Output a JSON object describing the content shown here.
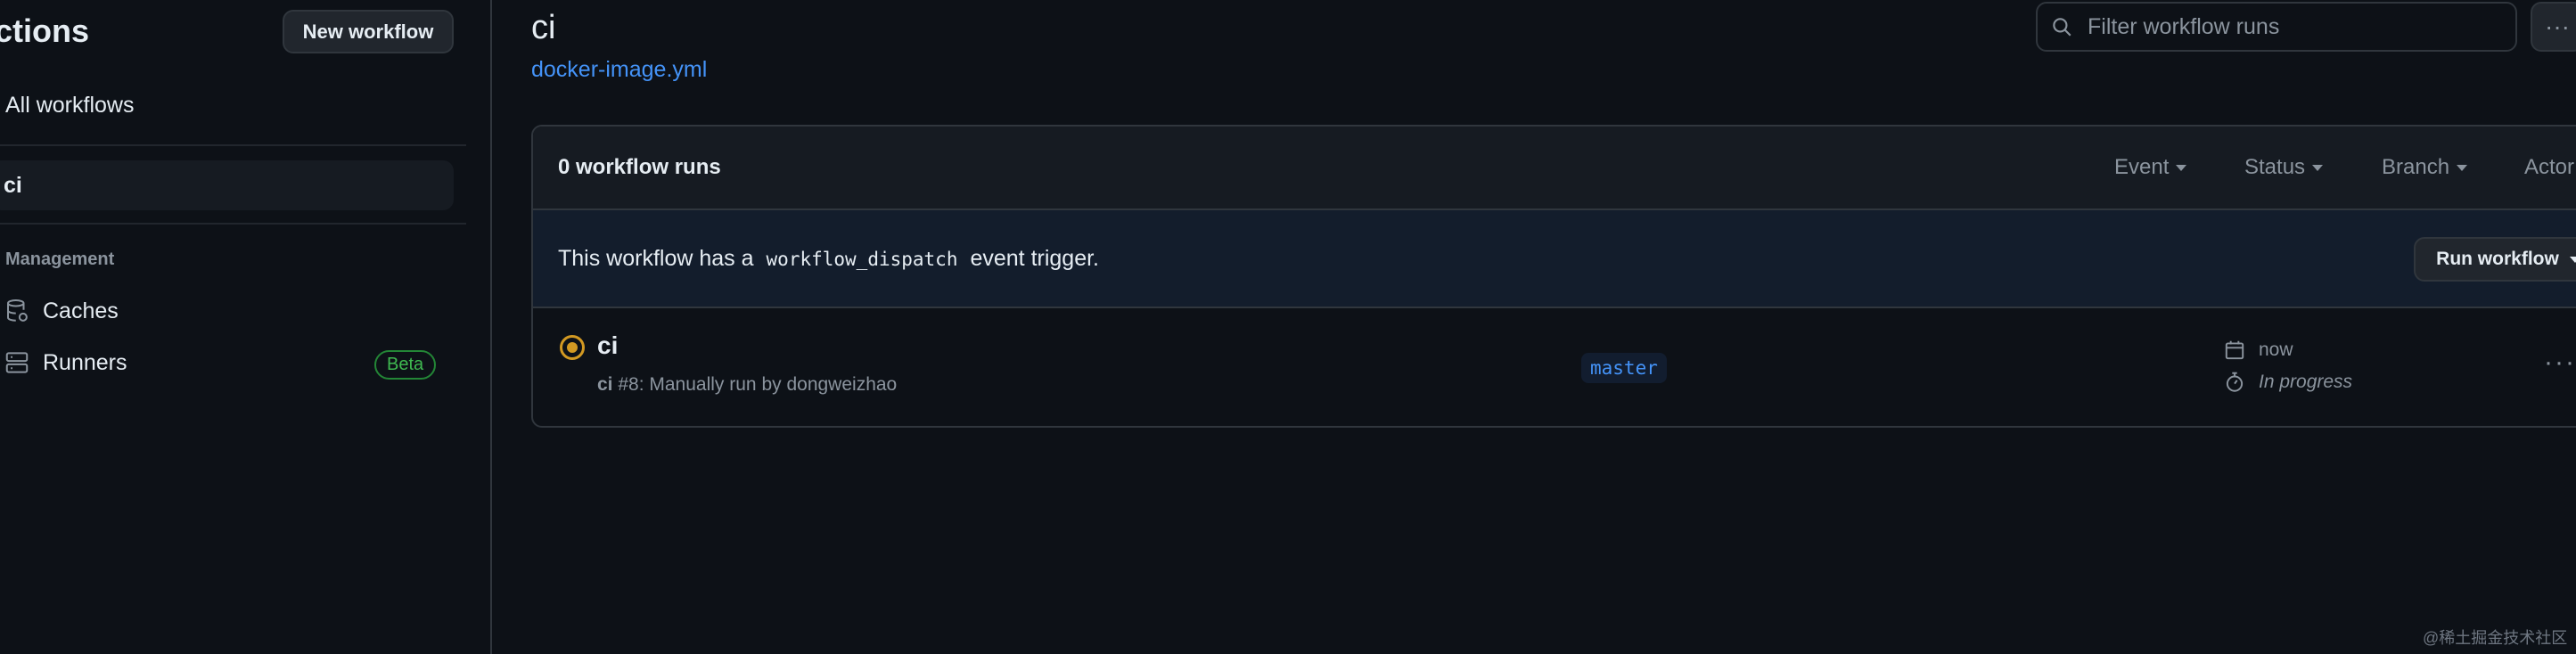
{
  "sidebar": {
    "title": "Actions",
    "new_workflow_label": "New workflow",
    "all_workflows_label": "All workflows",
    "selected_workflow": "ci",
    "management_label": "Management",
    "items": [
      {
        "label": "Caches",
        "icon": "database-icon"
      },
      {
        "label": "Runners",
        "icon": "server-icon",
        "badge": "Beta"
      }
    ]
  },
  "header": {
    "title": "ci",
    "workflow_file": "docker-image.yml",
    "search_placeholder": "Filter workflow runs",
    "more_label": "···"
  },
  "runs": {
    "count_label": "0 workflow runs",
    "filters": [
      "Event",
      "Status",
      "Branch",
      "Actor"
    ],
    "dispatch_prefix": "This workflow has a",
    "dispatch_code": "workflow_dispatch",
    "dispatch_suffix": "event trigger.",
    "run_workflow_label": "Run workflow",
    "items": [
      {
        "title": "ci",
        "workflow_name": "ci",
        "run_meta": "#8: Manually run by dongweizhao",
        "branch": "master",
        "time": "now",
        "duration": "In progress",
        "status": "in-progress",
        "status_color": "#d29922"
      }
    ]
  },
  "watermark": "@稀土掘金技术社区",
  "colors": {
    "background": "#0d1117",
    "link": "#4493f8",
    "badge_green": "#3fb950",
    "border": "#30363d"
  }
}
